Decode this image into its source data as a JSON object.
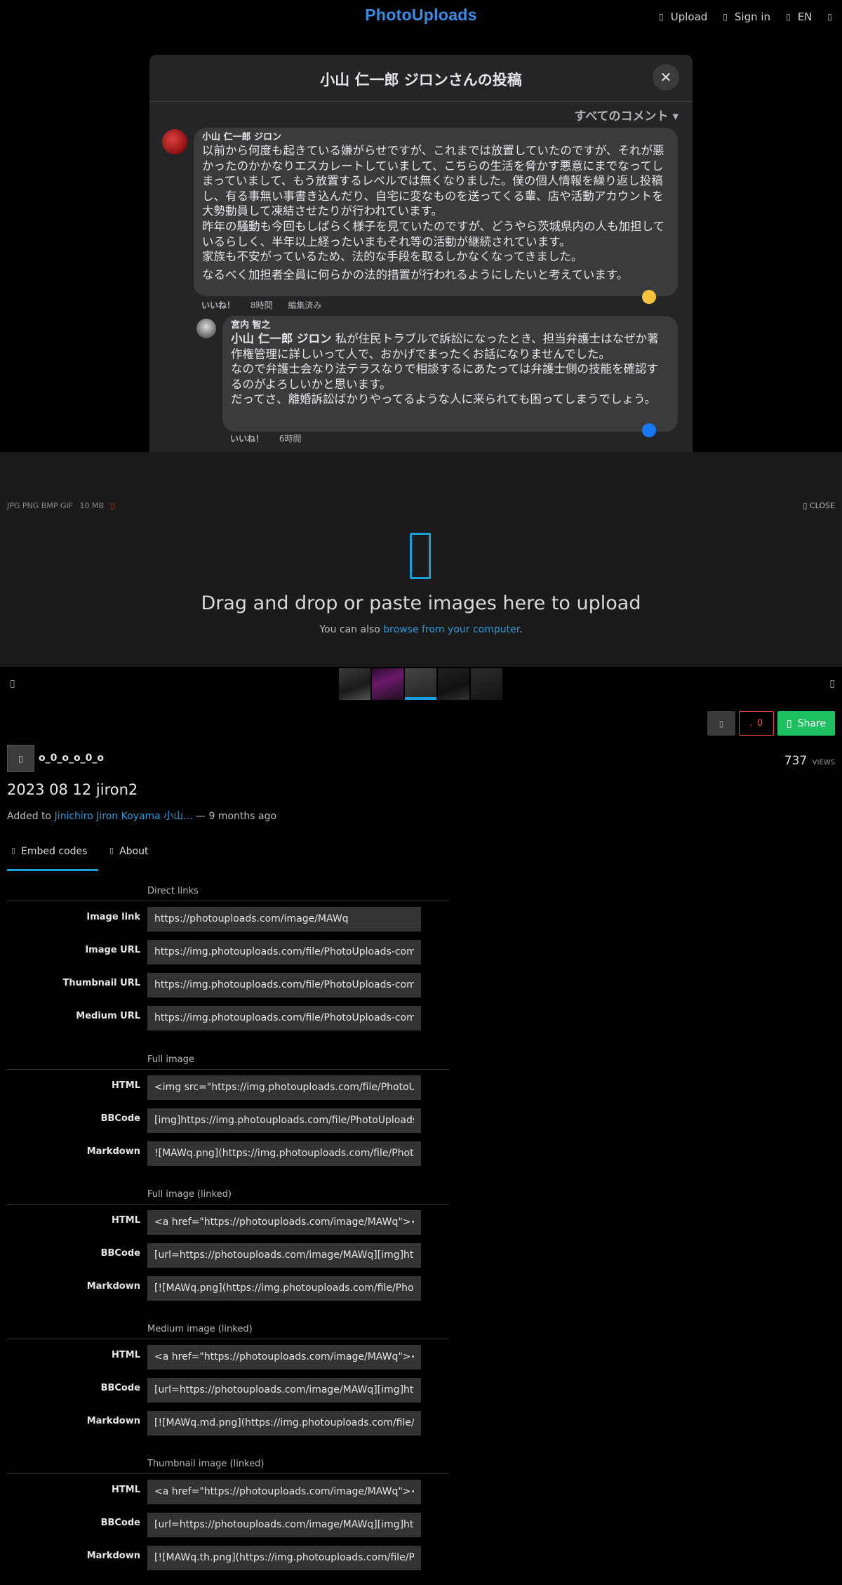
{
  "topbar": {
    "logo": "PhotoUploads",
    "upload_label": "Upload",
    "signin_label": "Sign in",
    "lang_label": "EN"
  },
  "screenshot": {
    "title": "小山 仁一郎 ジロンさんの投稿",
    "close_glyph": "✕",
    "all_comments": "すべてのコメント ▾",
    "comment1": {
      "author": "小山 仁一郎 ジロン",
      "para1": "以前から何度も起きている嫌がらせですが、これまでは放置していたのですが、それが悪かったのかかなりエスカレートしていまして、こちらの生活を脅かす悪意にまでなってしまっていまして、もう放置するレベルでは無くなりました。僕の個人情報を繰り返し投稿し、有る事無い事書き込んだり、自宅に変なものを送ってくる輩、店や活動アカウントを大勢動員して凍結させたりが行われています。",
      "para2": "昨年の騒動も今回もしばらく様子を見ていたのですが、どうやら茨城県内の人も加担しているらしく、半年以上経ったいまもそれ等の活動が継続されています。",
      "para3": "家族も不安がっているため、法的な手段を取るしかなくなってきました。",
      "para4": "なるべく加担者全員に何らかの法的措置が行われるようにしたいと考えています。",
      "like": "いいね！",
      "time": "8時間",
      "edited": "編集済み"
    },
    "comment2": {
      "author": "宮内 智之",
      "mention": "小山 仁一郎 ジロン",
      "text1": " 私が住民トラブルで訴訟になったとき、担当弁護士はなぜか著作権管理に詳しいって人で、おかげでまったくお話になりませんでした。",
      "text2": "なので弁護士会なり法テラスなりで相談するにあたっては弁護士側の技能を確認するのがよろしいかと思います。",
      "text3": "だってさ、離婚訴訟ばかりやってるような人に来られても困ってしまうでしょう。",
      "like": "いいね！",
      "time": "6時間"
    }
  },
  "upload": {
    "formats": "JPG PNG BMP GIF",
    "max_size": "10 MB",
    "close_label": "CLOSE",
    "title": "Drag and drop or paste images here to upload",
    "sub_prefix": "You can also ",
    "sub_link": "browse from your computer",
    "sub_suffix": "."
  },
  "actions": {
    "like_count": "0",
    "share_label": "Share"
  },
  "image": {
    "username": "o_0_o_o_0_o",
    "views": "737",
    "views_unit": "VIEWS",
    "title": "2023 08 12 jiron2",
    "added_prefix": "Added to ",
    "album": "Jinichiro Jiron Koyama 小山...",
    "added_suffix": " — 9 months ago"
  },
  "tabs": {
    "embed": "Embed codes",
    "about": "About"
  },
  "embed": {
    "direct": {
      "heading": "Direct links",
      "rows": [
        {
          "label": "Image link",
          "value": "https://photouploads.com/image/MAWq"
        },
        {
          "label": "Image URL",
          "value": "https://img.photouploads.com/file/PhotoUploads-com/MAWq.png"
        },
        {
          "label": "Thumbnail URL",
          "value": "https://img.photouploads.com/file/PhotoUploads-com/MAWq.th.png"
        },
        {
          "label": "Medium URL",
          "value": "https://img.photouploads.com/file/PhotoUploads-com/MAWq.md.png"
        }
      ]
    },
    "full": {
      "heading": "Full image",
      "rows": [
        {
          "label": "HTML",
          "value": "<img src=\"https://img.photouploads.com/file/PhotoUploads-com/MAWq.png\" alt=\"2023 08 12 jiron2\" border=\"0\">"
        },
        {
          "label": "BBCode",
          "value": "[img]https://img.photouploads.com/file/PhotoUploads-com/MAWq.png[/img]"
        },
        {
          "label": "Markdown",
          "value": "![MAWq.png](https://img.photouploads.com/file/PhotoUploads-com/MAWq.png)"
        }
      ]
    },
    "full_linked": {
      "heading": "Full image (linked)",
      "rows": [
        {
          "label": "HTML",
          "value": "<a href=\"https://photouploads.com/image/MAWq\"><img src=\"https://img.photouploads.com/file/PhotoUploads-com/MAWq.png\"></a>"
        },
        {
          "label": "BBCode",
          "value": "[url=https://photouploads.com/image/MAWq][img]https://img.photouploads.com/file/PhotoUploads-com/MAWq.png[/img][/url]"
        },
        {
          "label": "Markdown",
          "value": "[![MAWq.png](https://img.photouploads.com/file/PhotoUploads-com/MAWq.png)](https://photouploads.com/image/MAWq)"
        }
      ]
    },
    "medium_linked": {
      "heading": "Medium image (linked)",
      "rows": [
        {
          "label": "HTML",
          "value": "<a href=\"https://photouploads.com/image/MAWq\"><img src=\"https://img.photouploads.com/file/PhotoUploads-com/MAWq.md.png\"></a>"
        },
        {
          "label": "BBCode",
          "value": "[url=https://photouploads.com/image/MAWq][img]https://img.photouploads.com/file/PhotoUploads-com/MAWq.md.png[/img][/url]"
        },
        {
          "label": "Markdown",
          "value": "[![MAWq.md.png](https://img.photouploads.com/file/PhotoUploads-com/MAWq.md.png)](https://photouploads.com/image/MAWq)"
        }
      ]
    },
    "thumb_linked": {
      "heading": "Thumbnail image (linked)",
      "rows": [
        {
          "label": "HTML",
          "value": "<a href=\"https://photouploads.com/image/MAWq\"><img src=\"https://img.photouploads.com/file/PhotoUploads-com/MAWq.th.png\"></a>"
        },
        {
          "label": "BBCode",
          "value": "[url=https://photouploads.com/image/MAWq][img]https://img.photouploads.com/file/PhotoUploads-com/MAWq.th.png[/img][/url]"
        },
        {
          "label": "Markdown",
          "value": "[![MAWq.th.png](https://img.photouploads.com/file/PhotoUploads-com/MAWq.th.png)](https://photouploads.com/image/MAWq)"
        }
      ]
    }
  }
}
